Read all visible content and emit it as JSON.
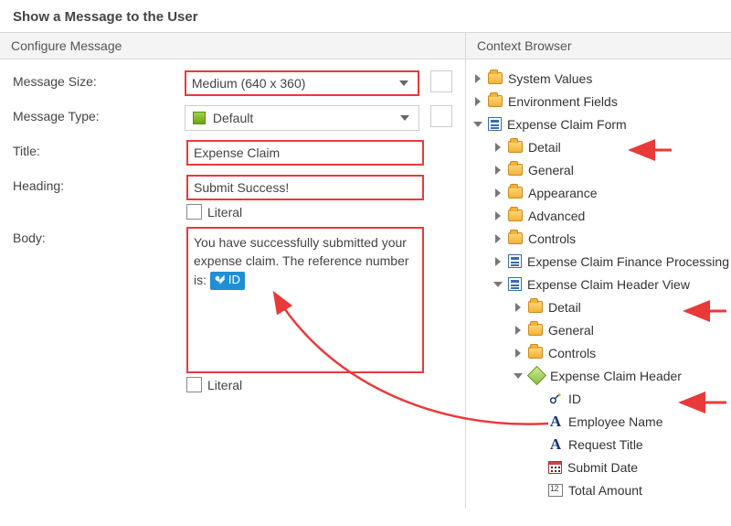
{
  "title": "Show a Message to the User",
  "panels": {
    "left_header": "Configure Message",
    "right_header": "Context Browser"
  },
  "form": {
    "size_label": "Message Size:",
    "size_value": "Medium (640 x 360)",
    "type_label": "Message Type:",
    "type_value": "Default",
    "title_label": "Title:",
    "title_value": "Expense Claim",
    "heading_label": "Heading:",
    "heading_value": "Submit Success!",
    "literal_label": "Literal",
    "body_label": "Body:",
    "body_text_before": "You have successfully submitted your expense claim. The reference number is: ",
    "body_chip_label": "ID"
  },
  "tree": {
    "system_values": "System Values",
    "environment_fields": "Environment Fields",
    "expense_claim_form": "Expense Claim Form",
    "detail": "Detail",
    "general": "General",
    "appearance": "Appearance",
    "advanced": "Advanced",
    "controls": "Controls",
    "finance_view": "Expense Claim Finance Processing Vie",
    "header_view": "Expense Claim Header View",
    "header_so": "Expense Claim Header",
    "prop_id": "ID",
    "prop_employee": "Employee Name",
    "prop_title": "Request Title",
    "prop_date": "Submit Date",
    "prop_total": "Total Amount"
  }
}
